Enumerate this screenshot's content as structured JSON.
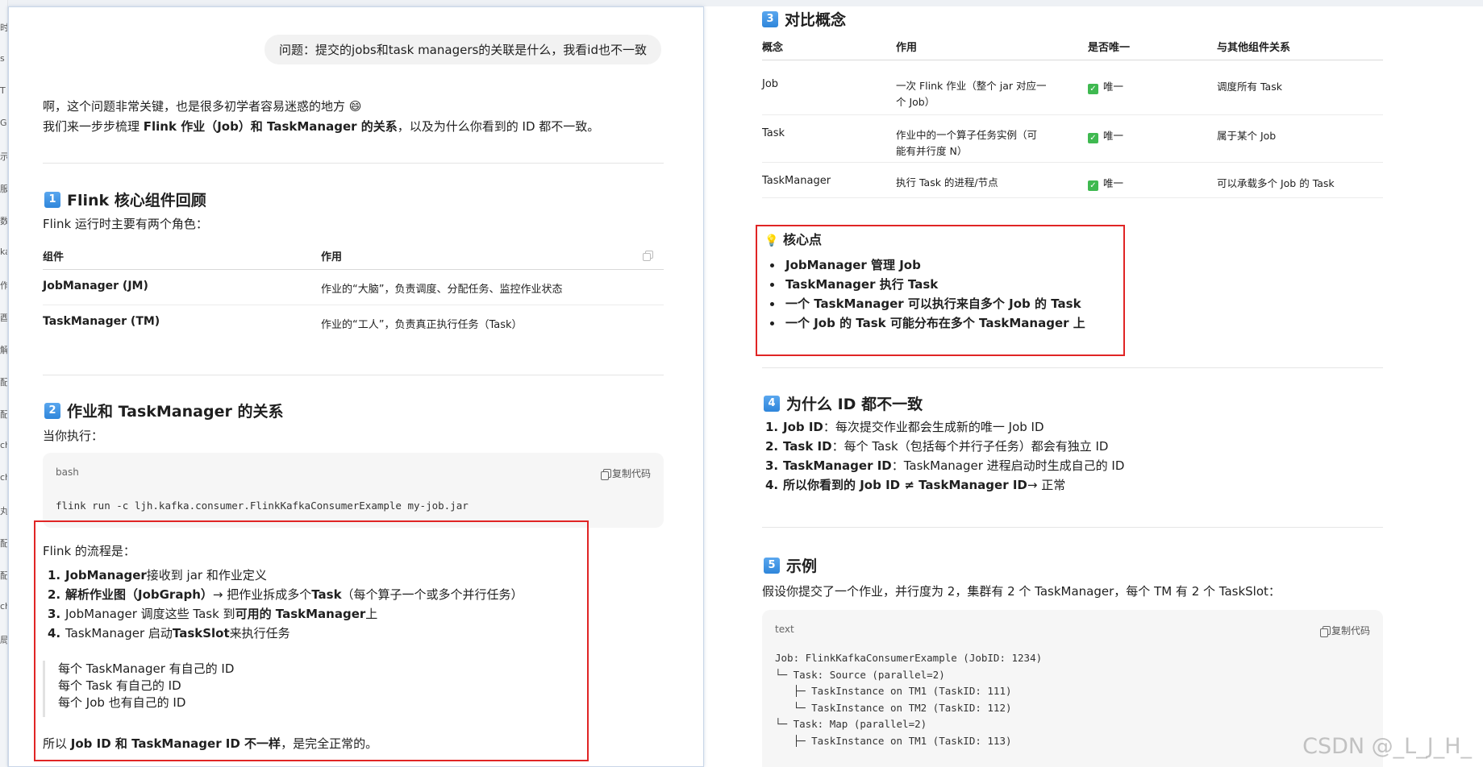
{
  "left_strip": [
    "时",
    "s",
    "T",
    "G",
    "示",
    "服",
    "数",
    "ka",
    "作",
    "酉",
    "解",
    "配",
    "配",
    "ch",
    "ch",
    "丸",
    "配",
    "配",
    "ch",
    "局"
  ],
  "question": "问题：提交的jobs和task managers的关联是什么，我看id也不一致",
  "intro": {
    "line1": "啊，这个问题非常关键，也是很多初学者容易迷惑的地方 😄",
    "line2_a": "我们来一步步梳理 ",
    "line2_b": "Flink 作业（Job）和 TaskManager 的关系",
    "line2_c": "，以及为什么你看到的 ID 都不一致。"
  },
  "section1": {
    "num": "1",
    "title": "Flink 核心组件回顾",
    "lead": "Flink 运行时主要有两个角色：",
    "headers": [
      "组件",
      "作用"
    ],
    "rows": [
      {
        "name": "JobManager (JM)",
        "role": "作业的“大脑”，负责调度、分配任务、监控作业状态"
      },
      {
        "name": "TaskManager (TM)",
        "role": "作业的“工人”，负责真正执行任务（Task）"
      }
    ]
  },
  "section2": {
    "num": "2",
    "title": "作业和 TaskManager 的关系",
    "lead": "当你执行：",
    "code_lang": "bash",
    "copy_label": "复制代码",
    "code": "flink run -c ljh.kafka.consumer.FlinkKafkaConsumerExample my-job.jar",
    "flow_lead": "Flink 的流程是：",
    "steps": [
      {
        "n": "1.",
        "a": "JobManager",
        "b": " 接收到 jar 和作业定义",
        "c": "",
        "d": ""
      },
      {
        "n": "2.",
        "a": "解析作业图（JobGraph）",
        "b": " → 把作业拆成多个 ",
        "c": "Task",
        "d": "（每个算子一个或多个并行任务）"
      },
      {
        "n": "3.",
        "a": "",
        "b": "JobManager 调度这些 Task 到 ",
        "c": "可用的 TaskManager",
        "d": " 上"
      },
      {
        "n": "4.",
        "a": "",
        "b": "TaskManager 启动 ",
        "c": "TaskSlot",
        "d": " 来执行任务"
      }
    ],
    "quote": [
      "每个 TaskManager 有自己的 ID",
      "每个 Task 有自己的 ID",
      "每个 Job 也有自己的 ID"
    ],
    "conclusion_a": "所以 ",
    "conclusion_b": "Job ID 和 TaskManager ID 不一样",
    "conclusion_c": "，是完全正常的。"
  },
  "section3": {
    "num": "3",
    "title": "对比概念",
    "headers": [
      "概念",
      "作用",
      "是否唯一",
      "与其他组件关系"
    ],
    "rows": [
      {
        "concept": "Job",
        "role1": "一次 Flink 作业（整个 jar 对应一",
        "role2": "个 Job）",
        "unique": "唯一",
        "rel": "调度所有 Task"
      },
      {
        "concept": "Task",
        "role1": "作业中的一个算子任务实例（可",
        "role2": "能有并行度 N）",
        "unique": "唯一",
        "rel": "属于某个 Job"
      },
      {
        "concept": "TaskManager",
        "role1": "执行 Task 的进程/节点",
        "role2": "",
        "unique": "唯一",
        "rel": "可以承载多个 Job 的 Task"
      }
    ]
  },
  "keypoint": {
    "icon": "💡",
    "title": "核心点",
    "items": [
      "JobManager 管理 Job",
      "TaskManager 执行 Task",
      "一个 TaskManager 可以执行来自多个 Job 的 Task",
      "一个 Job 的 Task 可能分布在多个 TaskManager 上"
    ]
  },
  "section4": {
    "num": "4",
    "title": "为什么 ID 都不一致",
    "items": [
      {
        "n": "1.",
        "a": "Job ID",
        "b": "：每次提交作业都会生成新的唯一 Job ID"
      },
      {
        "n": "2.",
        "a": "Task ID",
        "b": "：每个 Task（包括每个并行子任务）都会有独立 ID"
      },
      {
        "n": "3.",
        "a": "TaskManager ID",
        "b": "：TaskManager 进程启动时生成自己的 ID"
      },
      {
        "n": "4.",
        "a": "所以你看到的 Job ID ≠ TaskManager ID",
        "b": " → 正常"
      }
    ]
  },
  "section5": {
    "num": "5",
    "title": "示例",
    "lead": "假设你提交了一个作业，并行度为 2，集群有 2 个 TaskManager，每个 TM 有 2 个 TaskSlot：",
    "code_lang": "text",
    "copy_label": "复制代码",
    "code_lines": [
      "Job: FlinkKafkaConsumerExample (JobID: 1234)",
      "└─ Task: Source (parallel=2)",
      "   ├─ TaskInstance on TM1 (TaskID: 111)",
      "   └─ TaskInstance on TM2 (TaskID: 112)",
      "└─ Task: Map (parallel=2)",
      "   ├─ TaskInstance on TM1 (TaskID: 113)"
    ]
  },
  "watermark": "CSDN @_L_J_H_"
}
